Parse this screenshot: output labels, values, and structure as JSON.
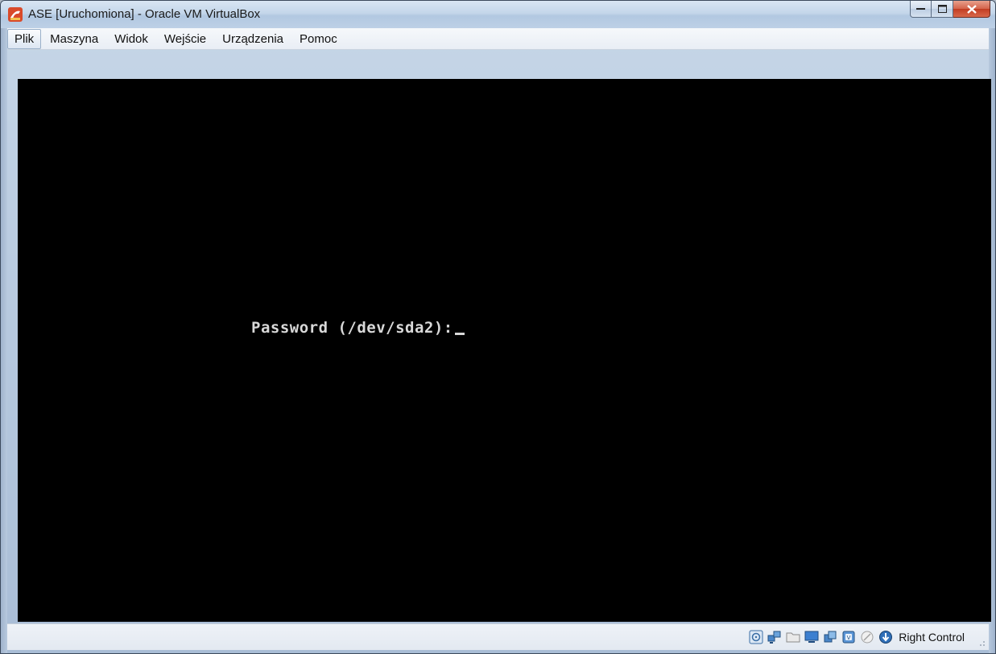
{
  "window": {
    "title": "ASE [Uruchomiona] - Oracle VM VirtualBox"
  },
  "menu": {
    "items": [
      {
        "label": "Plik"
      },
      {
        "label": "Maszyna"
      },
      {
        "label": "Widok"
      },
      {
        "label": "Wejście"
      },
      {
        "label": "Urządzenia"
      },
      {
        "label": "Pomoc"
      }
    ]
  },
  "console": {
    "prompt": "Password (/dev/sda2):"
  },
  "statusbar": {
    "host_key": "Right Control",
    "icons": [
      "hard-disk-icon",
      "network-icon",
      "shared-folders-icon",
      "display-icon",
      "usb-icon",
      "cpu-virtualization-icon",
      "mouse-integration-icon",
      "keyboard-capture-icon"
    ]
  },
  "colors": {
    "screen_bg": "#000000",
    "console_text": "#d8d8d8",
    "close_button": "#c23d22"
  }
}
